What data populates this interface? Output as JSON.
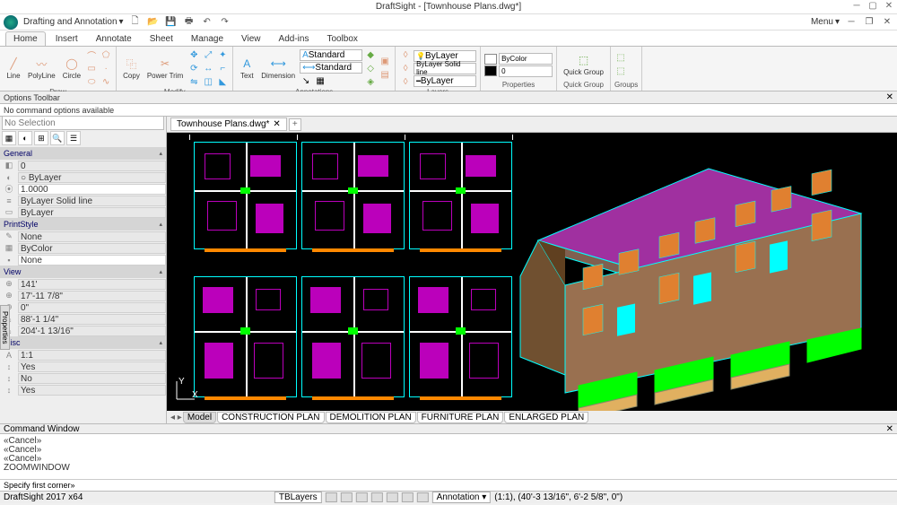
{
  "app": {
    "title": "DraftSight - [Townhouse Plans.dwg*]"
  },
  "qat": {
    "workspace": "Drafting and Annotation",
    "menu": "Menu"
  },
  "ribbon": {
    "tabs": [
      "Home",
      "Insert",
      "Annotate",
      "Sheet",
      "Manage",
      "View",
      "Add-ins",
      "Toolbox"
    ],
    "active": "Home",
    "groups": {
      "draw": {
        "label": "Draw",
        "items": [
          "Line",
          "PolyLine",
          "Circle"
        ]
      },
      "modify": {
        "label": "Modify",
        "items": [
          "Copy",
          "Power Trim"
        ]
      },
      "annotations": {
        "label": "Annotations",
        "items": [
          "Text",
          "Dimension"
        ],
        "style1": "Standard",
        "style2": "Standard"
      },
      "layers": {
        "label": "Layers",
        "layer": "ByLayer",
        "line1": "ByLayer  Solid line",
        "line2": "ByLayer"
      },
      "properties": {
        "label": "Properties",
        "color": "ByColor",
        "val": "0"
      },
      "quick": {
        "label": "Quick Group",
        "item": "Quick Group"
      },
      "groups": {
        "label": "Groups"
      }
    }
  },
  "options": {
    "title": "Options Toolbar",
    "msg": "No command options available"
  },
  "properties_panel": {
    "selection": "No Selection",
    "sections": {
      "general": {
        "label": "General",
        "rows": [
          {
            "icon": "◧",
            "val": "0"
          },
          {
            "icon": "◐",
            "val": "○ ByLayer"
          },
          {
            "icon": "⦿",
            "val": "1.0000"
          },
          {
            "icon": "≡",
            "val": "ByLayer  Solid line"
          },
          {
            "icon": "▭",
            "val": "ByLayer"
          }
        ]
      },
      "printstyle": {
        "label": "PrintStyle",
        "rows": [
          {
            "icon": "✎",
            "val": "None"
          },
          {
            "icon": "▦",
            "val": "ByColor"
          },
          {
            "icon": "▪",
            "val": "None"
          }
        ]
      },
      "view": {
        "label": "View",
        "rows": [
          {
            "icon": "⊕",
            "val": "141'"
          },
          {
            "icon": "⊕",
            "val": "17'-11 7/8\""
          },
          {
            "icon": "⊕",
            "val": "0\""
          },
          {
            "icon": "⌂",
            "val": "88'-1 1/4\""
          },
          {
            "icon": "⌂",
            "val": "204'-1 13/16\""
          }
        ]
      },
      "misc": {
        "label": "Misc",
        "rows": [
          {
            "icon": "A",
            "val": "1:1"
          },
          {
            "icon": "↕",
            "val": "Yes"
          },
          {
            "icon": "↕",
            "val": "No"
          },
          {
            "icon": "↕",
            "val": "Yes"
          }
        ]
      }
    }
  },
  "doc": {
    "tab": "Townhouse Plans.dwg*"
  },
  "sheets": [
    "Model",
    "CONSTRUCTION PLAN",
    "DEMOLITION PLAN",
    "FURNITURE PLAN",
    "ENLARGED PLAN"
  ],
  "cmd": {
    "title": "Command Window",
    "lines": [
      "«Cancel»",
      "«Cancel»",
      "«Cancel»",
      "ZOOMWINDOW"
    ],
    "prompt": "Specify first corner»"
  },
  "status": {
    "app": "DraftSight 2017 x64",
    "layer": "TBLayers",
    "ann": "Annotation",
    "coord": "(1:1), (40'-3 13/16\", 6'-2 5/8\", 0\")"
  },
  "vtab": "Properties"
}
